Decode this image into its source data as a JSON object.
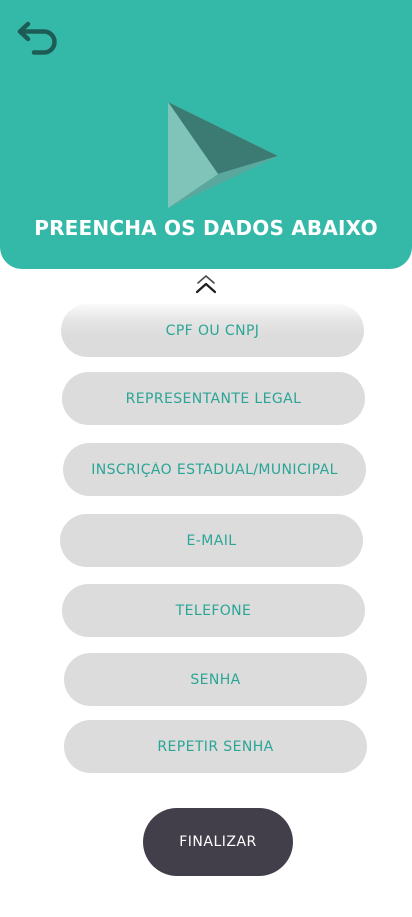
{
  "header": {
    "title": "PREENCHA OS DADOS ABAIXO",
    "background_color": "#34b9a8",
    "back_icon": "undo-arrow-icon",
    "logo_icon": "play-triangle-logo"
  },
  "form": {
    "collapse_icon": "double-chevron-up-icon",
    "fields": {
      "cpf_cnpj": {
        "placeholder": "CPF OU CNPJ",
        "value": ""
      },
      "legal_representative": {
        "placeholder": "REPRESENTANTE LEGAL",
        "value": ""
      },
      "registration": {
        "placeholder": "INSCRIÇÃO ESTADUAL/MUNICIPAL",
        "value": ""
      },
      "email": {
        "placeholder": "E-MAIL",
        "value": ""
      },
      "phone": {
        "placeholder": "TELEFONE",
        "value": ""
      },
      "password": {
        "placeholder": "SENHA",
        "value": ""
      },
      "repeat_password": {
        "placeholder": "REPETIR SENHA",
        "value": ""
      }
    },
    "field_background": "#dcdcdc",
    "field_text_color": "#2aa596",
    "submit": {
      "label": "FINALIZAR",
      "background_color": "#423f4b"
    }
  }
}
